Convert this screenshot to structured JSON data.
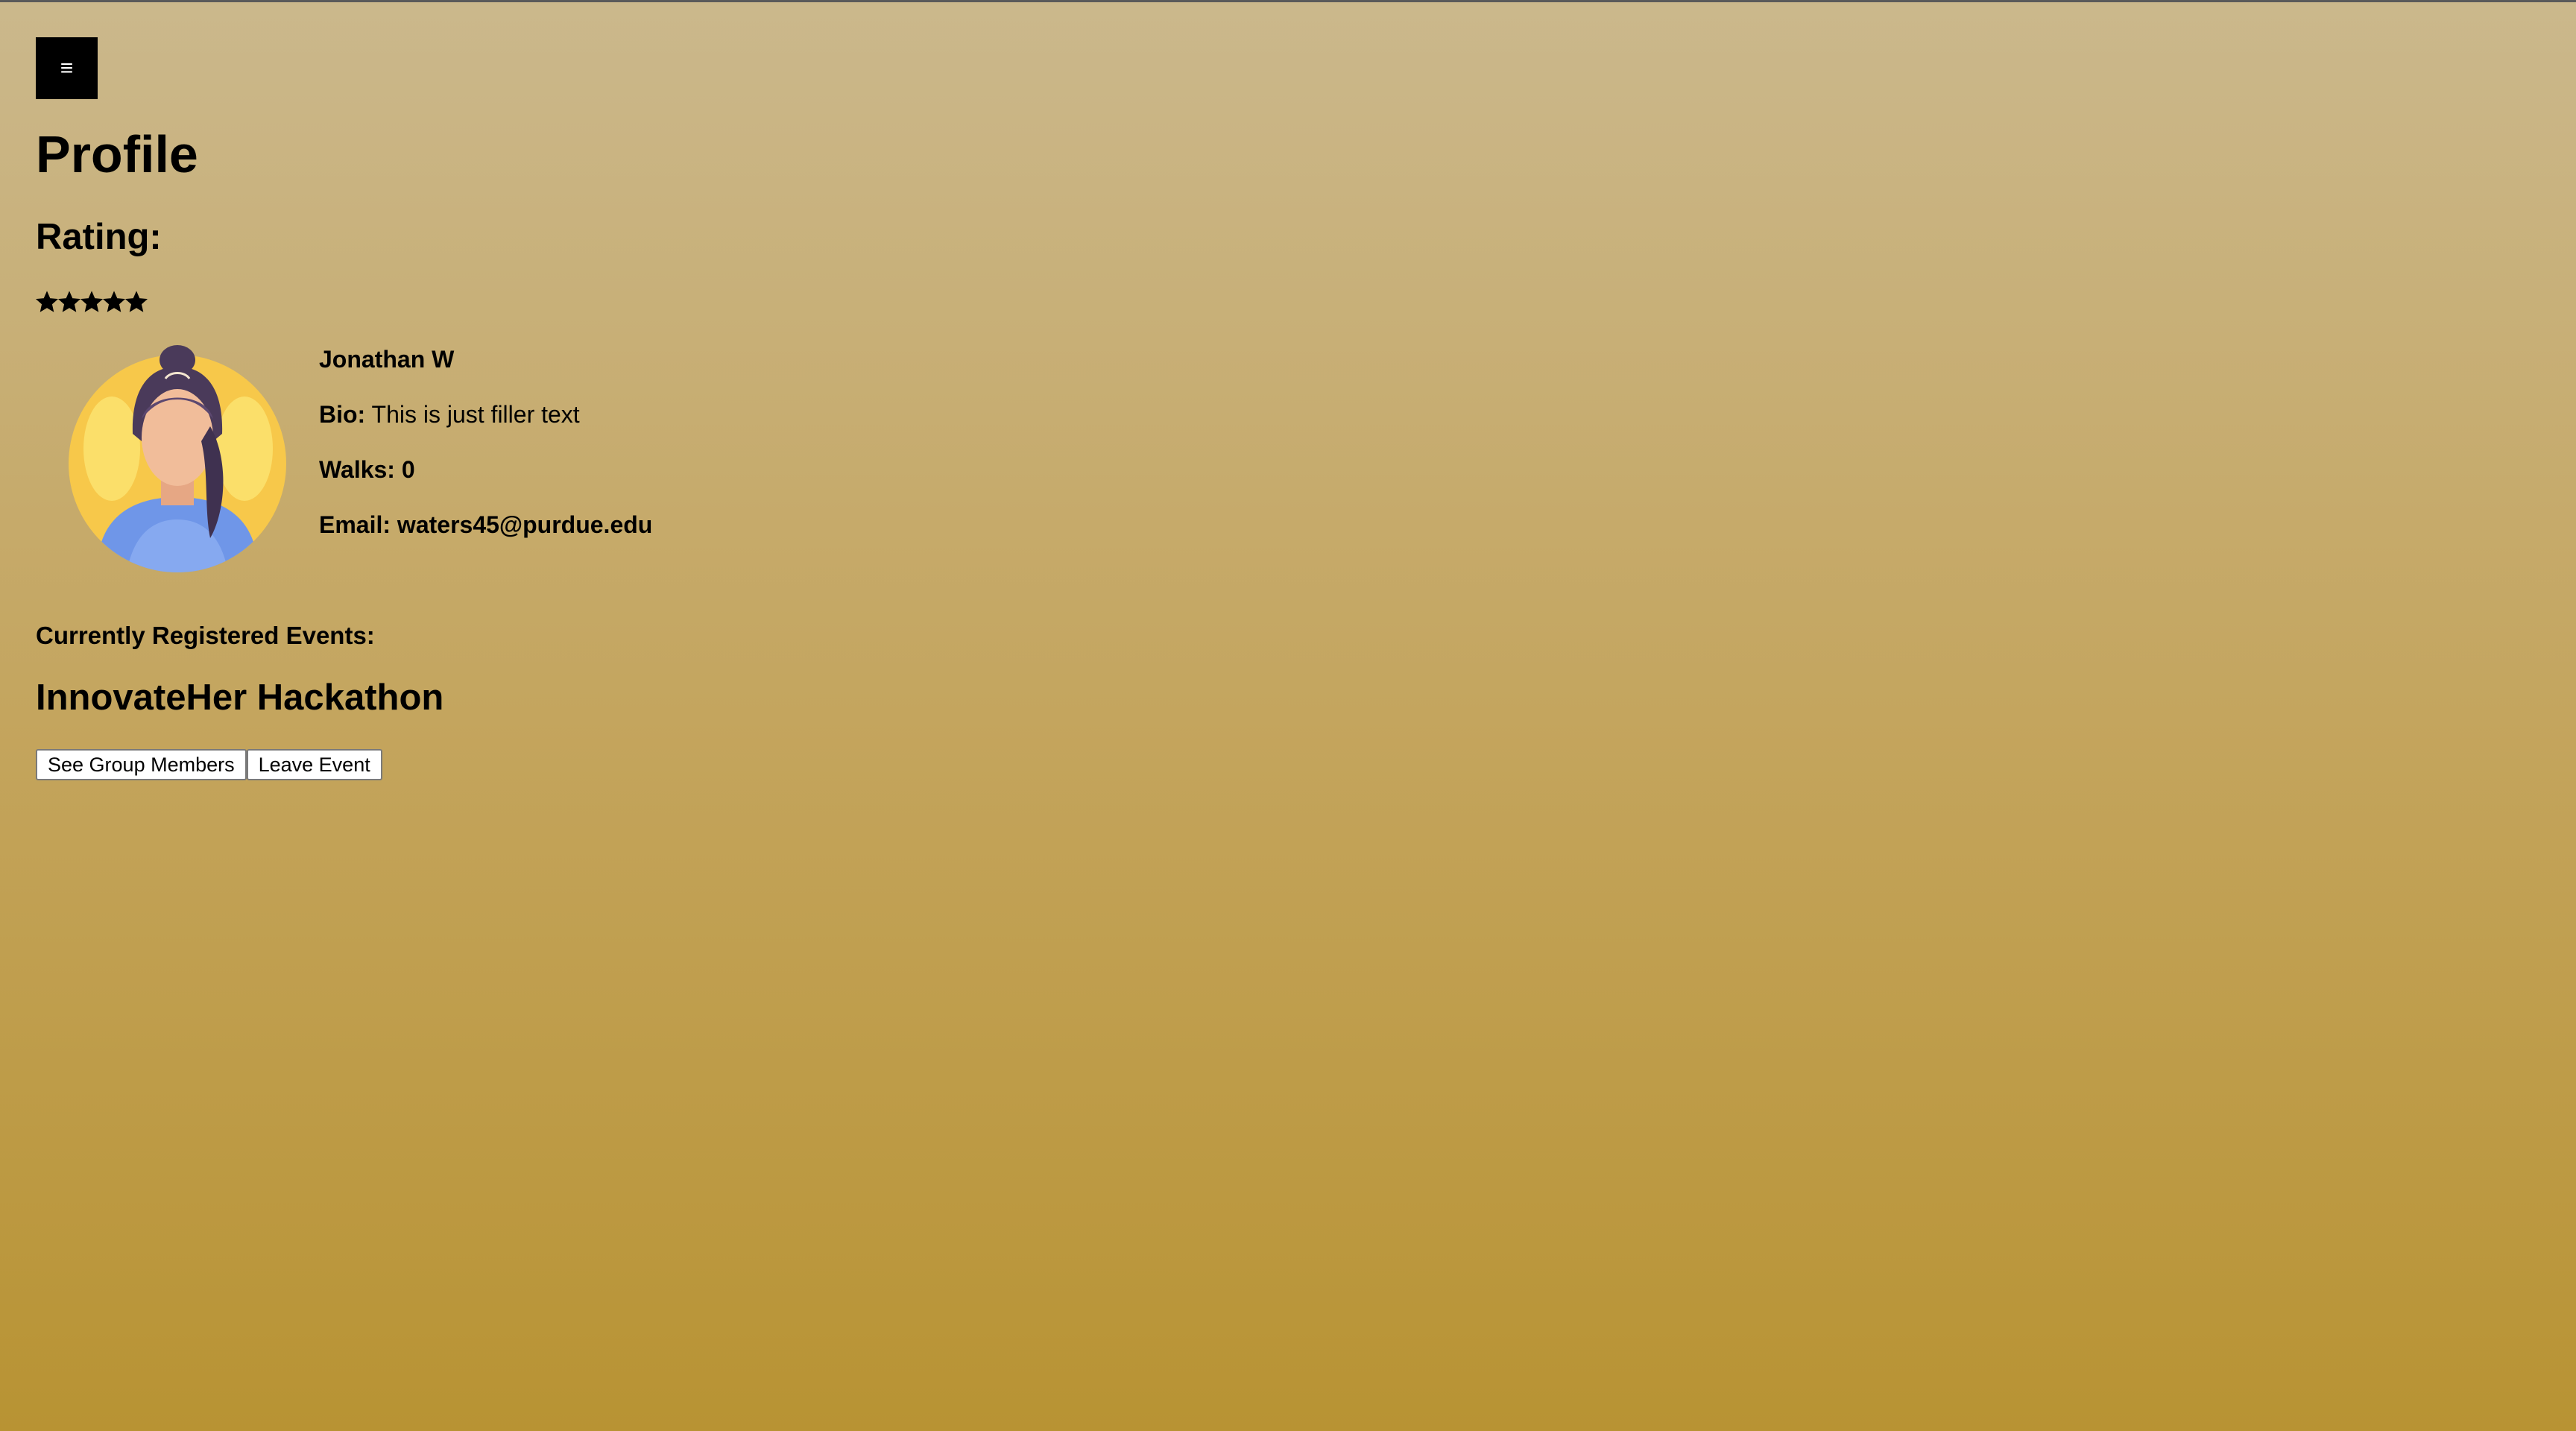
{
  "menu": {
    "icon": "hamburger-menu-icon",
    "glyph": "≡"
  },
  "profile": {
    "title": "Profile",
    "rating_label": "Rating:",
    "rating_value": 5,
    "rating_max": 5
  },
  "user": {
    "name": "Jonathan W",
    "bio_label": "Bio:",
    "bio_text": " This is just filler text",
    "walks": "Walks: 0",
    "email": "Email: waters45@purdue.edu"
  },
  "events": {
    "label": "Currently Registered Events:",
    "items": [
      {
        "title": "InnovateHer Hackathon",
        "see_members_label": "See Group Members",
        "leave_label": "Leave Event"
      }
    ]
  },
  "colors": {
    "background_top": "#cbb88c",
    "background_bottom": "#b89333",
    "menu_bg": "#000000",
    "avatar_bg": "#f7c84a",
    "shirt": "#6f96e8"
  }
}
